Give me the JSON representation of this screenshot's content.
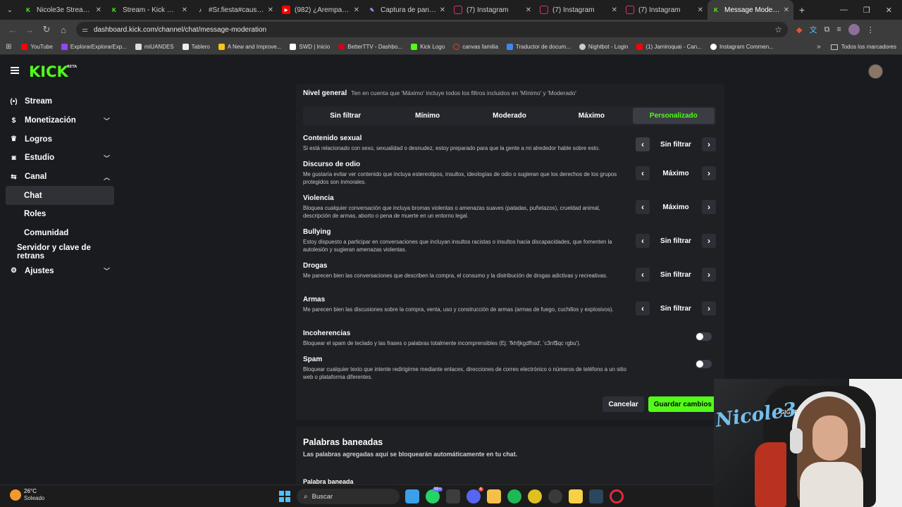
{
  "browser": {
    "tabs": [
      {
        "title": "Nicole3e Stream - W",
        "color": "#53fc18",
        "glyph": "K"
      },
      {
        "title": "Stream - Kick Dashbo",
        "color": "#53fc18",
        "glyph": "K"
      },
      {
        "title": "#Sr.fiesta#causa#apo",
        "color": "#222222",
        "glyph": "♪"
      },
      {
        "title": "(982) ¿Arempanadas",
        "color": "#ff0000",
        "glyph": "▶"
      },
      {
        "title": "Captura de pantalla",
        "color": "#8a5cf6",
        "glyph": "✎"
      },
      {
        "title": "(7) Instagram",
        "color": "#e1306c",
        "glyph": "◎"
      },
      {
        "title": "(7) Instagram",
        "color": "#e1306c",
        "glyph": "◎"
      },
      {
        "title": "(7) Instagram",
        "color": "#e1306c",
        "glyph": "◎"
      },
      {
        "title": "Message Moderation",
        "color": "#53fc18",
        "glyph": "K",
        "active": true
      }
    ],
    "url": "dashboard.kick.com/channel/chat/message-moderation",
    "bookmarks": [
      {
        "label": "YouTube",
        "color": "#ff0000"
      },
      {
        "label": "ExplorarExplorarExp...",
        "color": "#9146ff"
      },
      {
        "label": "miUANDES",
        "color": "#dddddd"
      },
      {
        "label": "Tablero",
        "color": "#eeeeee"
      },
      {
        "label": "A New and Improve...",
        "color": "#f5c518"
      },
      {
        "label": "SWD | Inicio",
        "color": "#ffffff"
      },
      {
        "label": "BetterTTV - Dashbo...",
        "color": "#d50014"
      },
      {
        "label": "Kick Logo",
        "color": "#53fc18"
      },
      {
        "label": "canvas familia",
        "color": "#e23e2b"
      },
      {
        "label": "Traductor de docum...",
        "color": "#4285f4"
      },
      {
        "label": "Nightbot - Login",
        "color": "#cccccc"
      },
      {
        "label": "(1) Jamiroquai - Can...",
        "color": "#ff0000"
      },
      {
        "label": "Instagram Commen...",
        "color": "#ffffff"
      }
    ],
    "all_bookmarks": "Todos los marcadores"
  },
  "app": {
    "logo": "KICK",
    "logo_badge": "BETA"
  },
  "sidebar": {
    "items": [
      {
        "label": "Stream",
        "icon": "((•))"
      },
      {
        "label": "Monetización",
        "icon": "$"
      },
      {
        "label": "Logros",
        "icon": "🏆"
      },
      {
        "label": "Estudio",
        "icon": "⊡"
      },
      {
        "label": "Canal",
        "icon": "⇆"
      },
      {
        "label": "Chat"
      },
      {
        "label": "Roles"
      },
      {
        "label": "Comunidad"
      },
      {
        "label": "Servidor y clave de retrans"
      },
      {
        "label": "Ajustes",
        "icon": "⚙"
      }
    ]
  },
  "moderation": {
    "level_title": "Nivel general",
    "level_hint": "Ten en cuenta que 'Máximo' incluye todos los filtros incluidos en 'Mínimo' y 'Moderado'",
    "levels": [
      "Sin filtrar",
      "Mínimo",
      "Moderado",
      "Máximo",
      "Personalizado"
    ],
    "selected_level": "Personalizado",
    "rules": [
      {
        "title": "Contenido sexual",
        "desc": "Si está relacionado con sexo, sexualidad o desnudez, estoy preparado para que la gente a mi alrededor hable sobre esto.",
        "value": "Sin filtrar"
      },
      {
        "title": "Discurso de odio",
        "desc": "Me gustaría evitar ver contenido que incluya estereotipos, insultos, ideologías de odio o sugieran que los derechos de los grupos protegidos son inmorales.",
        "value": "Máximo"
      },
      {
        "title": "Violencia",
        "desc": "Bloquea cualquier conversación que incluya bromas violentas o amenazas suaves (patadas, puñetazos), crueldad animal, descripción de armas, aborto o pena de muerte en un entorno legal.",
        "value": "Máximo"
      },
      {
        "title": "Bullying",
        "desc": "Estoy dispuesto a participar en conversaciones que incluyan insultos racistas o insultos hacia discapacidades, que fomenten la autolesión y sugieran amenazas violentas.",
        "value": "Sin filtrar"
      },
      {
        "title": "Drogas",
        "desc": "Me parecen bien las conversaciones que describen la compra, el consumo y la distribución de drogas adictivas y recreativas.",
        "value": "Sin filtrar"
      },
      {
        "title": "Armas",
        "desc": "Me parecen bien las discusiones sobre la compra, venta, uso y construcción de armas (armas de fuego, cuchillos y explosivos).",
        "value": "Sin filtrar"
      }
    ],
    "toggles": [
      {
        "title": "Incoherencias",
        "desc": "Bloquear el spam de teclado y las frases o palabras totalmente incomprensibles (Ej: 'fkhfjkgdfhsd', 'c3nf$qc rgbu').",
        "enabled": false
      },
      {
        "title": "Spam",
        "desc": "Bloquear cualquier texto que intente redirigirme mediante enlaces, direcciones de correo electrónico o números de teléfono a un sitio web o plataforma diferentes.",
        "enabled": false
      }
    ],
    "cancel_label": "Cancelar",
    "save_label": "Guardar cambios"
  },
  "banned_words": {
    "title": "Palabras baneadas",
    "desc": "Las palabras agregadas aquí se bloquearán automáticamente en tu chat.",
    "field_label": "Palabra baneada"
  },
  "webcam": {
    "sign_text": "Nicole3",
    "chair_brand": "GIGAB"
  },
  "taskbar": {
    "temperature": "26°C",
    "condition": "Soleado",
    "search_placeholder": "Buscar",
    "badge_1": "99+",
    "badge_2": "4"
  },
  "colors": {
    "accent": "#53fc18",
    "background": "#191b1f",
    "card": "#1e2024"
  }
}
